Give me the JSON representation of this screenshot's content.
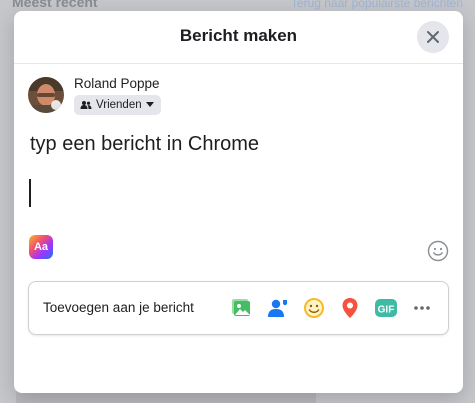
{
  "background": {
    "left_header": "Meest recent",
    "right_link": "Terug naar populairste berichten"
  },
  "dialog": {
    "title": "Bericht maken",
    "author": {
      "name": "Roland Poppe",
      "audience": "Vrienden"
    },
    "composer_text": "typ een bericht in Chrome",
    "text_style_label": "Aa",
    "add_to_post": {
      "label": "Toevoegen aan je bericht",
      "icons": [
        {
          "name": "photo-video-icon",
          "color": "#45bd62"
        },
        {
          "name": "tag-people-icon",
          "color": "#1877f2"
        },
        {
          "name": "feeling-activity-icon",
          "color": "#f7b928"
        },
        {
          "name": "check-in-icon",
          "color": "#f5533d"
        },
        {
          "name": "gif-icon",
          "color": "#3ebaa5",
          "text": "GIF"
        },
        {
          "name": "more-icon",
          "color": "#65676b"
        }
      ]
    }
  }
}
